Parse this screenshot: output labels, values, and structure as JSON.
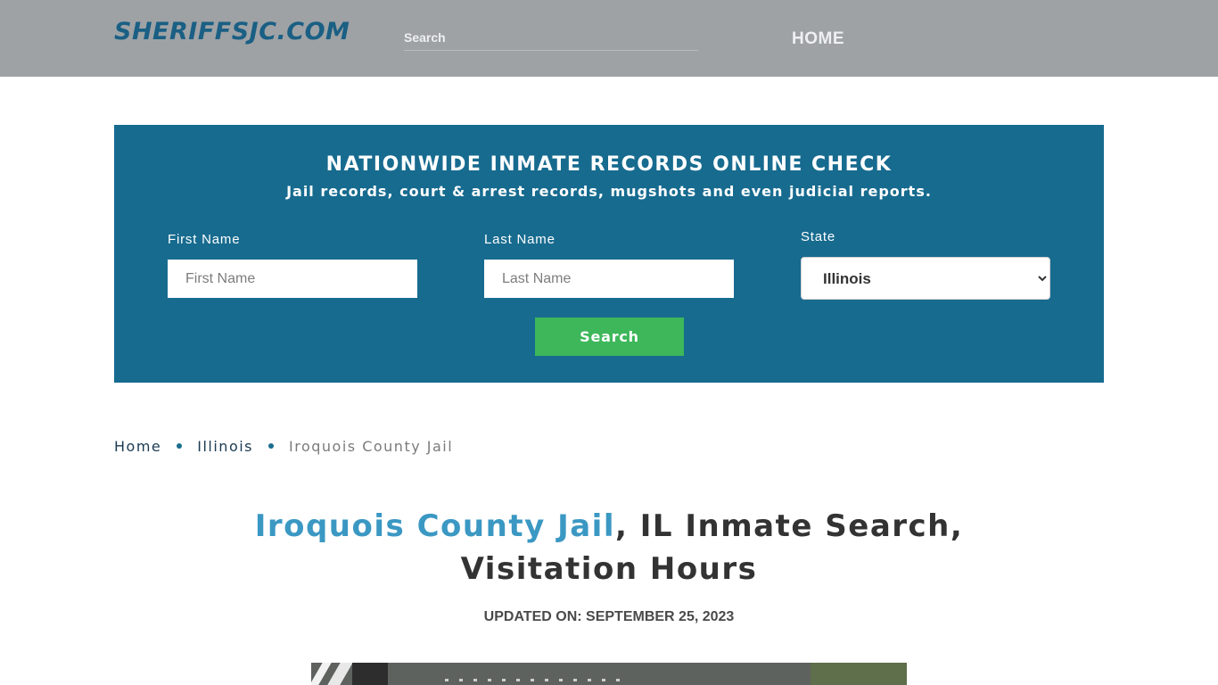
{
  "header": {
    "logo": "SHERIFFSJC.COM",
    "search_placeholder": "Search",
    "nav_home": "HOME"
  },
  "hero": {
    "title": "NATIONWIDE INMATE RECORDS ONLINE CHECK",
    "subtitle": "Jail records, court & arrest records, mugshots and even judicial reports.",
    "first_name_label": "First Name",
    "first_name_placeholder": "First Name",
    "last_name_label": "Last Name",
    "last_name_placeholder": "Last Name",
    "state_label": "State",
    "state_selected": "Illinois",
    "search_button": "Search"
  },
  "breadcrumb": {
    "items": [
      "Home",
      "Illinois",
      "Iroquois County Jail"
    ]
  },
  "page": {
    "title_highlight": "Iroquois County Jail",
    "title_rest": ", IL Inmate Search, Visitation Hours",
    "updated": "UPDATED ON: SEPTEMBER 25, 2023"
  },
  "colors": {
    "header_bg": "#9ea2a5",
    "hero_bg": "#176b8f",
    "button_bg": "#3db75a",
    "title_highlight": "#3b98c3"
  }
}
